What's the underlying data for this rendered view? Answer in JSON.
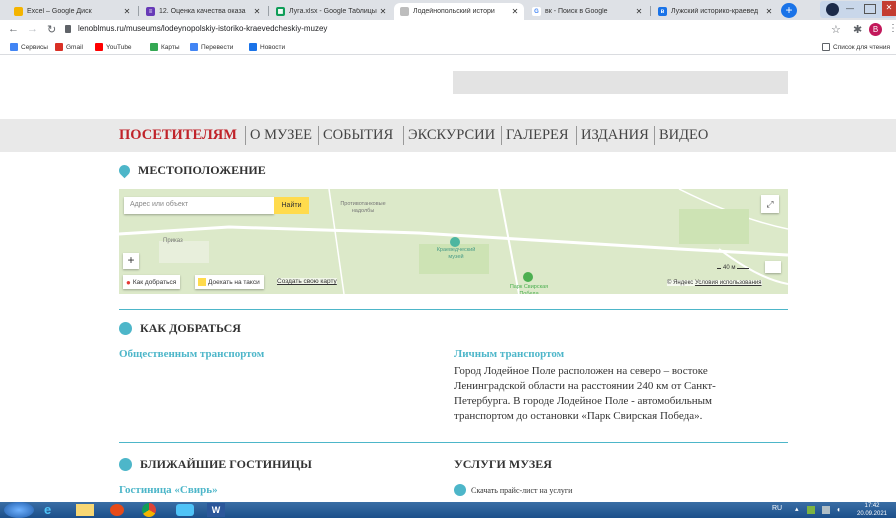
{
  "tabs": [
    {
      "title": "Excel – Google Диск",
      "color": "#f4b400"
    },
    {
      "title": "12. Оценка качества оказа",
      "color": "#673ab7"
    },
    {
      "title": "Луга.xlsx - Google Таблицы",
      "color": "#0f9d58"
    },
    {
      "title": "Лодейнопольский истори",
      "color": "#bdbdbd"
    },
    {
      "title": "вк - Поиск в Google",
      "color": "#4285f4"
    },
    {
      "title": "Лужский историко-краевед",
      "color": "#1a73e8"
    }
  ],
  "address_bar": {
    "url": "lenoblmus.ru/museums/lodeynopolskiy-istoriko-kraevedcheskiy-muzey"
  },
  "bookmarks": [
    {
      "label": "Сервисы",
      "color": "#4285f4"
    },
    {
      "label": "Gmail",
      "color": "#d93025"
    },
    {
      "label": "YouTube",
      "color": "#ff0000"
    },
    {
      "label": "Карты",
      "color": "#34a853"
    },
    {
      "label": "Перевести",
      "color": "#4285f4"
    },
    {
      "label": "Новости",
      "color": "#1a73e8"
    }
  ],
  "reading_list": "Список для чтения",
  "nav": {
    "items": [
      "ПОСЕТИТЕЛЯМ",
      "О МУЗЕЕ",
      "СОБЫТИЯ",
      "ЭКСКУРСИИ",
      "ГАЛЕРЕЯ",
      "ИЗДАНИЯ",
      "ВИДЕО"
    ],
    "active_color": "#c0232a"
  },
  "location": {
    "heading": "МЕСТОПОЛОЖЕНИЕ",
    "map": {
      "search_placeholder": "Адрес или объект",
      "search_button": "Найти",
      "labels": {
        "nadolby": "Противотанковые надолбы",
        "prikaz": "Приказ",
        "museum": "Краеведческий музей",
        "park": "Парк Свирская Победа"
      },
      "route_button": "Как добраться",
      "taxi_button": "Доехать на такси",
      "create_map": "Создать свою карту",
      "scale": "40 м",
      "copyright": "© Яндекс",
      "terms": "Условия использования",
      "zoom_in": "+"
    }
  },
  "directions": {
    "heading": "КАК ДОБРАТЬСЯ",
    "public_transport": "Общественным транспортом",
    "private_transport": "Личным транспортом",
    "private_text": "Город Лодейное Поле расположен на северо – востоке Ленинградской области на расстоянии 240 км от Санкт-Петербурга. В городе Лодейное Поле - автомобильным транспортом до остановки «Парк Свирская Победа»."
  },
  "hotels": {
    "heading": "БЛИЖАЙШИЕ ГОСТИНИЦЫ",
    "first": "Гостиница «Свирь»"
  },
  "services": {
    "heading": "УСЛУГИ МУЗЕЯ",
    "price_link": "Скачать прайс-лист на услуги"
  },
  "taskbar": {
    "lang": "RU",
    "time": "17:42",
    "date": "20.09.2021"
  },
  "accent": "#4db6c9"
}
